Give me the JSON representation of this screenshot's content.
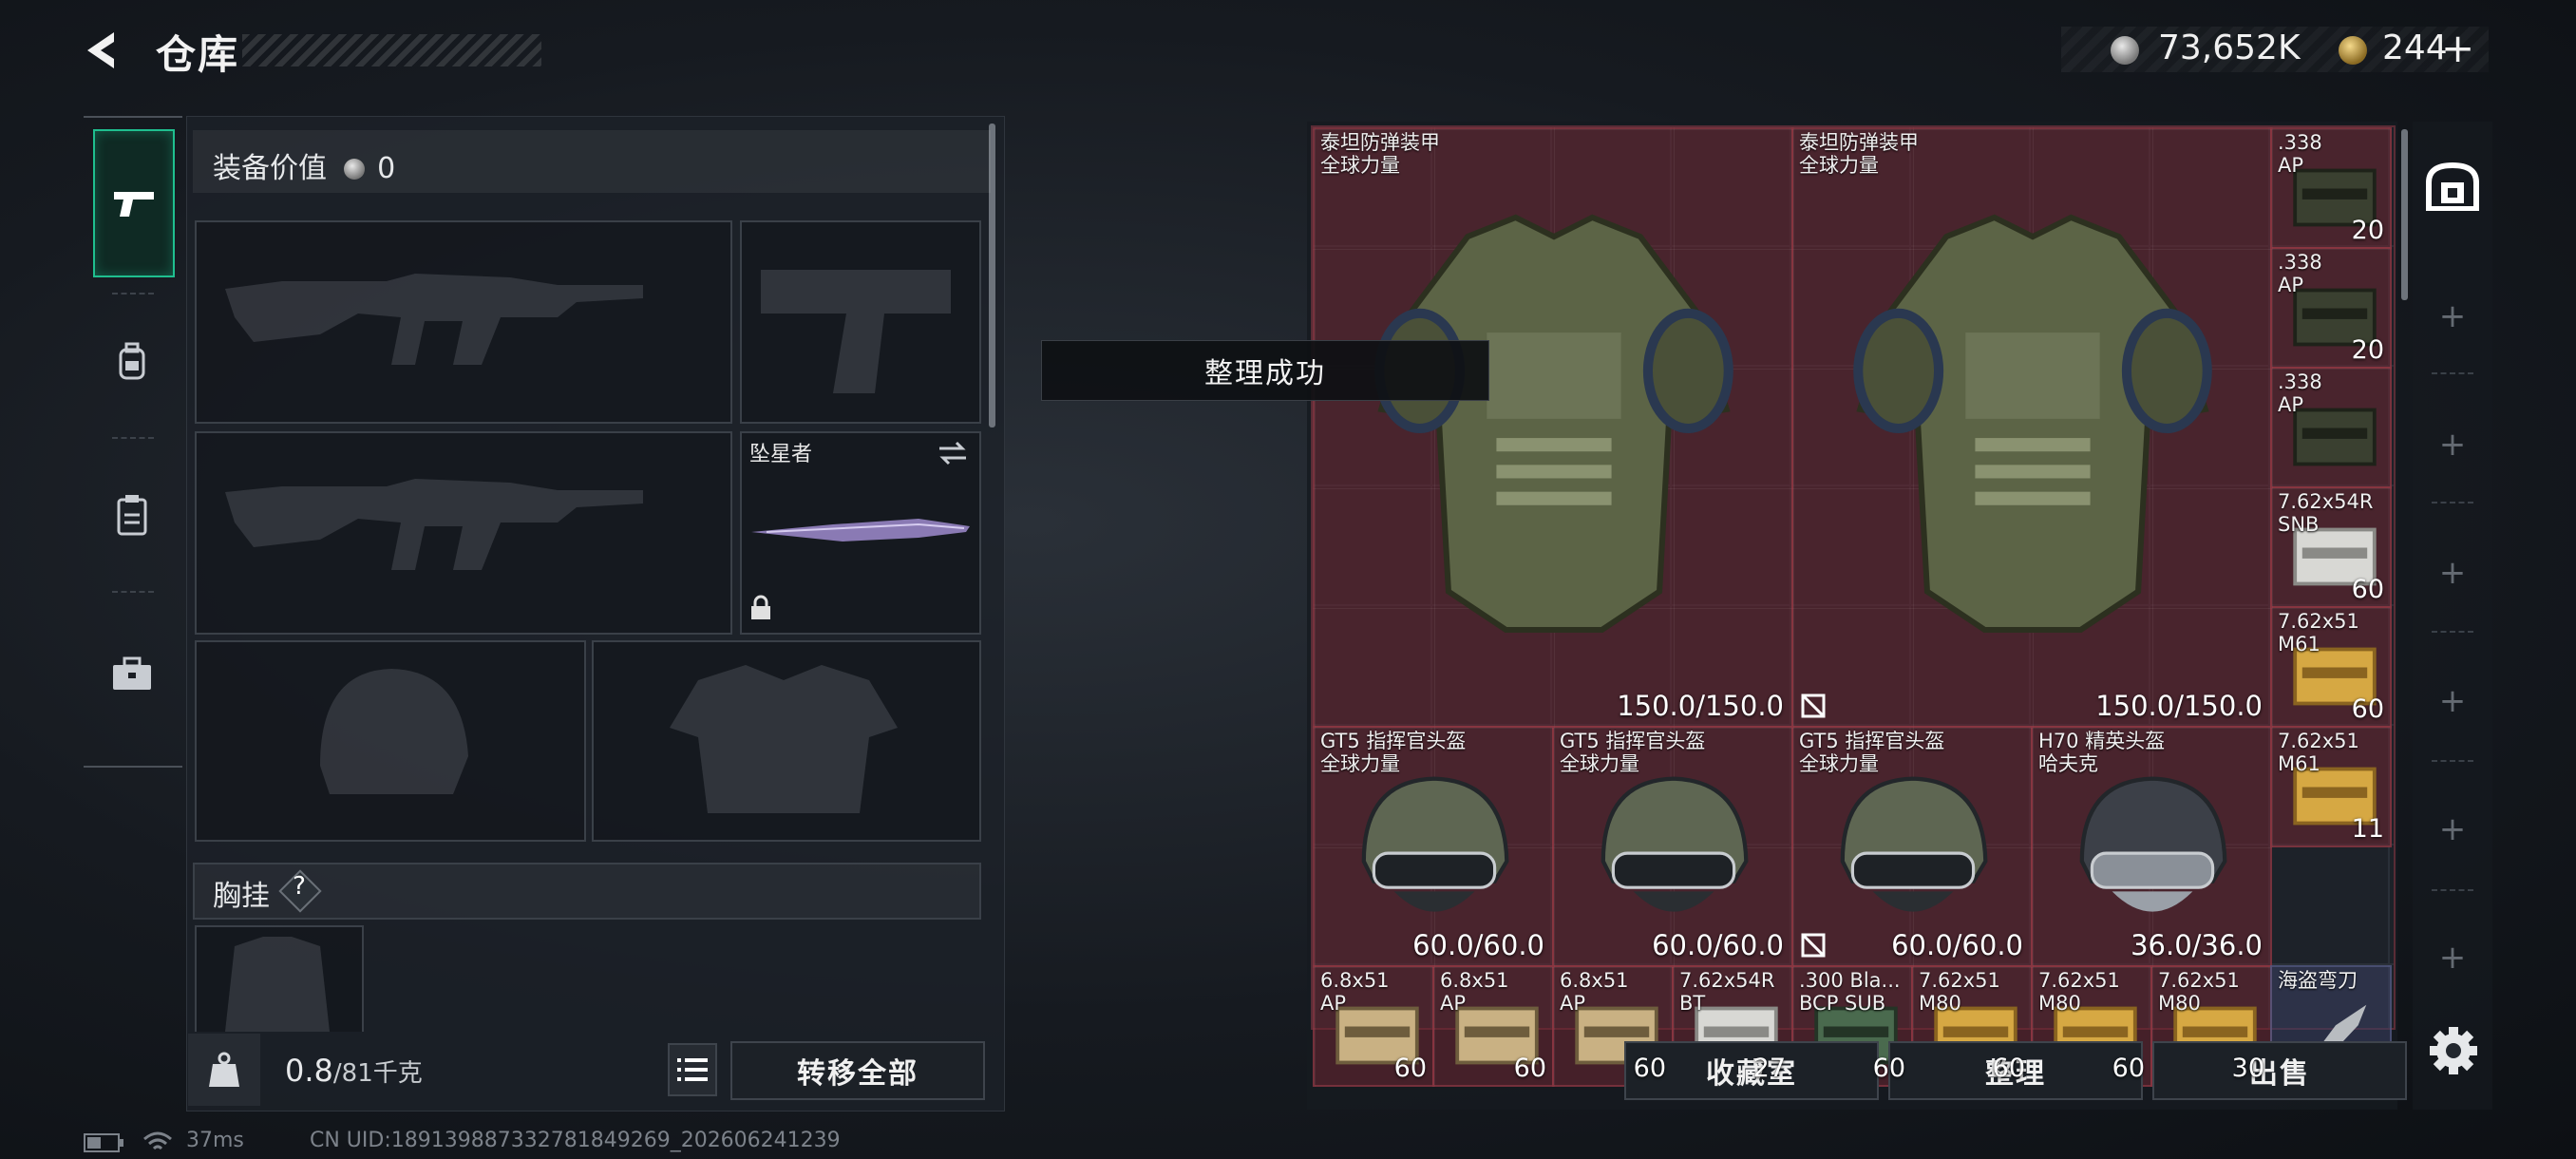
{
  "header": {
    "title": "仓库",
    "currency": [
      {
        "name": "silver-coin-icon",
        "value": "73,652K"
      },
      {
        "name": "gold-coin-icon",
        "value": "244"
      }
    ],
    "add_label": "+"
  },
  "tabs": [
    {
      "name": "tab-weapons",
      "icon": "pistol-icon",
      "active": true
    },
    {
      "name": "tab-backpack",
      "icon": "backpack-icon",
      "active": false
    },
    {
      "name": "tab-chest-rig",
      "icon": "clipboard-icon",
      "active": false
    },
    {
      "name": "tab-case",
      "icon": "briefcase-icon",
      "active": false
    }
  ],
  "loadout": {
    "value_label": "装备价值",
    "value_amount": "0",
    "melee_slot_name": "坠星者",
    "chest_rig_label": "胸挂",
    "help_mark": "?"
  },
  "bottom_left": {
    "weight_current": "0.8",
    "weight_total": "/81千克",
    "transfer_all": "转移全部"
  },
  "toast": "整理成功",
  "storage_items": [
    {
      "name": "泰坦防弹装甲",
      "sub": "全球力量",
      "durability": "150.0/150.0",
      "kind": "armor",
      "no_insure": false
    },
    {
      "name": "泰坦防弹装甲",
      "sub": "全球力量",
      "durability": "150.0/150.0",
      "kind": "armor",
      "no_insure": true
    },
    {
      "name": ".338",
      "sub": "AP",
      "qty": "20",
      "kind": "ammo-dark"
    },
    {
      "name": ".338",
      "sub": "AP",
      "qty": "20",
      "kind": "ammo-dark"
    },
    {
      "name": ".338",
      "sub": "AP",
      "qty": "",
      "kind": "ammo-dark"
    },
    {
      "name": "7.62x54R",
      "sub": "SNB",
      "qty": "60",
      "kind": "ammo-white"
    },
    {
      "name": "GT5 指挥官头盔",
      "sub": "全球力量",
      "durability": "60.0/60.0",
      "kind": "helmet",
      "no_insure": false
    },
    {
      "name": "GT5 指挥官头盔",
      "sub": "全球力量",
      "durability": "60.0/60.0",
      "kind": "helmet",
      "no_insure": false
    },
    {
      "name": "GT5 指挥官头盔",
      "sub": "全球力量",
      "durability": "60.0/60.0",
      "kind": "helmet",
      "no_insure": true
    },
    {
      "name": "H70 精英头盔",
      "sub": "哈夫克",
      "durability": "36.0/36.0",
      "kind": "helmet-h70",
      "no_insure": false
    },
    {
      "name": "7.62x51",
      "sub": "M61",
      "qty": "60",
      "kind": "ammo-gold"
    },
    {
      "name": "7.62x51",
      "sub": "M61",
      "qty": "11",
      "kind": "ammo-gold"
    },
    {
      "name": "6.8x51",
      "sub": "AP",
      "qty": "60",
      "kind": "ammo-tan"
    },
    {
      "name": "6.8x51",
      "sub": "AP",
      "qty": "60",
      "kind": "ammo-tan"
    },
    {
      "name": "6.8x51",
      "sub": "AP",
      "qty": "60",
      "kind": "ammo-tan"
    },
    {
      "name": "7.62x54R",
      "sub": "BT",
      "qty": "27",
      "kind": "ammo-white"
    },
    {
      "name": ".300 Bla...",
      "sub": "BCP SUB",
      "qty": "60",
      "kind": "ammo-green"
    },
    {
      "name": "7.62x51",
      "sub": "M80",
      "qty": "60",
      "kind": "ammo-gold"
    },
    {
      "name": "7.62x51",
      "sub": "M80",
      "qty": "60",
      "kind": "ammo-gold"
    },
    {
      "name": "7.62x51",
      "sub": "M80",
      "qty": "30",
      "kind": "ammo-gold"
    },
    {
      "name": "海盗弯刀",
      "sub": "",
      "qty": "",
      "kind": "knife"
    }
  ],
  "bottom_right": {
    "collection": "收藏室",
    "sort": "整理",
    "sell": "出售"
  },
  "rail": {
    "plus_label": "+"
  },
  "status_bar": {
    "ping": "37ms",
    "uid": "CN UID:1891398873327818492​69_202606241239"
  }
}
